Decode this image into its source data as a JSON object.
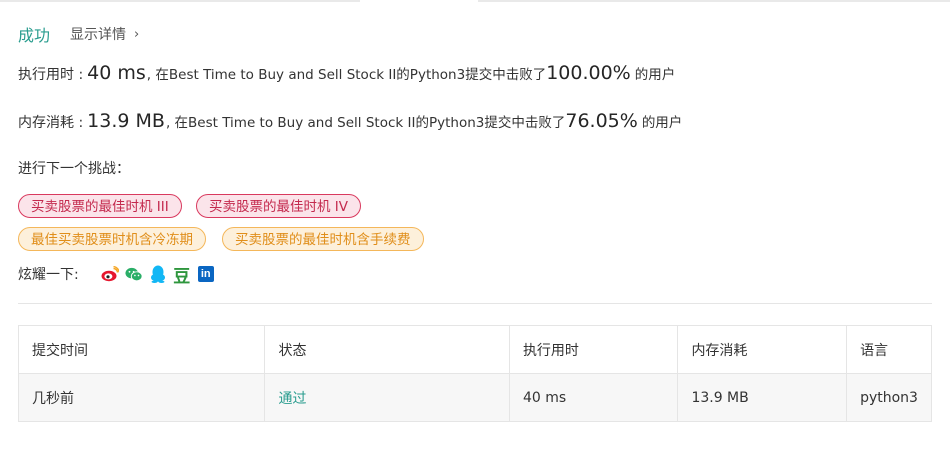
{
  "result": {
    "status_label": "成功",
    "details_label": "显示详情"
  },
  "runtime": {
    "label": "执行用时 :",
    "value": "40 ms",
    "mid": ", 在Best Time to Buy and Sell Stock II的Python3提交中击败了",
    "percent": "100.00%",
    "tail": "的用户"
  },
  "memory": {
    "label": "内存消耗 :",
    "value": "13.9 MB",
    "mid": ", 在Best Time to Buy and Sell Stock II的Python3提交中击败了",
    "percent": "76.05%",
    "tail": "的用户"
  },
  "next_challenge": {
    "label": "进行下一个挑战：",
    "tags": [
      {
        "label": "买卖股票的最佳时机 III",
        "difficulty": "hard"
      },
      {
        "label": "买卖股票的最佳时机 IV",
        "difficulty": "hard"
      },
      {
        "label": "最佳买卖股票时机含冷冻期",
        "difficulty": "medium"
      },
      {
        "label": "买卖股票的最佳时机含手续费",
        "difficulty": "medium"
      }
    ]
  },
  "share": {
    "label": "炫耀一下:",
    "icons": [
      "weibo-icon",
      "wechat-icon",
      "qq-icon",
      "douban-icon",
      "linkedin-icon"
    ],
    "douban_glyph": "豆",
    "linkedin_glyph": "in"
  },
  "submissions": {
    "headers": [
      "提交时间",
      "状态",
      "执行用时",
      "内存消耗",
      "语言"
    ],
    "rows": [
      {
        "time": "几秒前",
        "status": "通过",
        "runtime": "40 ms",
        "memory": "13.9 MB",
        "language": "python3"
      }
    ]
  },
  "colors": {
    "accent": "#2a9d8f",
    "hard_border": "#d9395e",
    "hard_bg": "#fbe4ea",
    "medium_border": "#f4b75a",
    "medium_bg": "#fdf0db",
    "weibo": "#e6162d",
    "wechat": "#2aae67",
    "qq": "#12b7f5",
    "douban": "#2e963d",
    "linkedin": "#0a66c2"
  }
}
